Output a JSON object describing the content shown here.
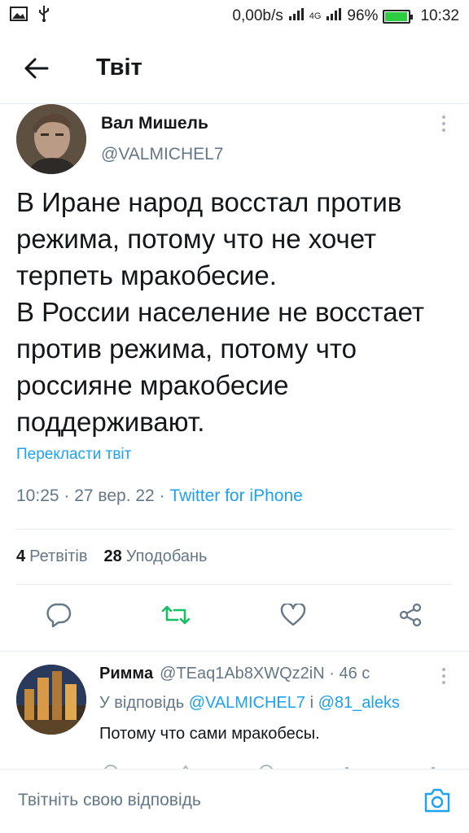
{
  "status_bar": {
    "net_speed": "0,00b/s",
    "network_label": "4G",
    "battery_pct_text": "96%",
    "battery_level": 0.96,
    "time": "10:32",
    "left_icons": [
      "image-icon",
      "usb-icon"
    ]
  },
  "header": {
    "title": "Твіт",
    "back_icon": "arrow-left-icon"
  },
  "tweet": {
    "author_name": "Вал Мишель",
    "author_handle": "@VALMICHEL7",
    "text": "В Иране народ восстал против режима, потому что не хочет терпеть мракобесие.\nВ России население не восстает против режима, потому что россияне мракобесие поддерживают.",
    "translate_label": "Перекласти твіт",
    "time": "10:25",
    "date": "27 вер. 22",
    "source": "Twitter for iPhone",
    "retweets_count": "4",
    "retweets_label": "Ретвітів",
    "likes_count": "28",
    "likes_label": "Уподобань",
    "accent_color": "#1da1f2",
    "retweet_color": "#17bf63"
  },
  "reply": {
    "name": "Римма",
    "handle": "@TEaq1Ab8XWQz2iN",
    "age": "46 с",
    "reply_prefix": "У відповідь",
    "reply_to_1": "@VALMICHEL7",
    "reply_conj": "і",
    "reply_to_2": "@81_aleks",
    "text": "Потому что сами мракобесы."
  },
  "compose": {
    "placeholder": "Твітніть свою відповідь",
    "camera_icon": "camera-icon"
  }
}
